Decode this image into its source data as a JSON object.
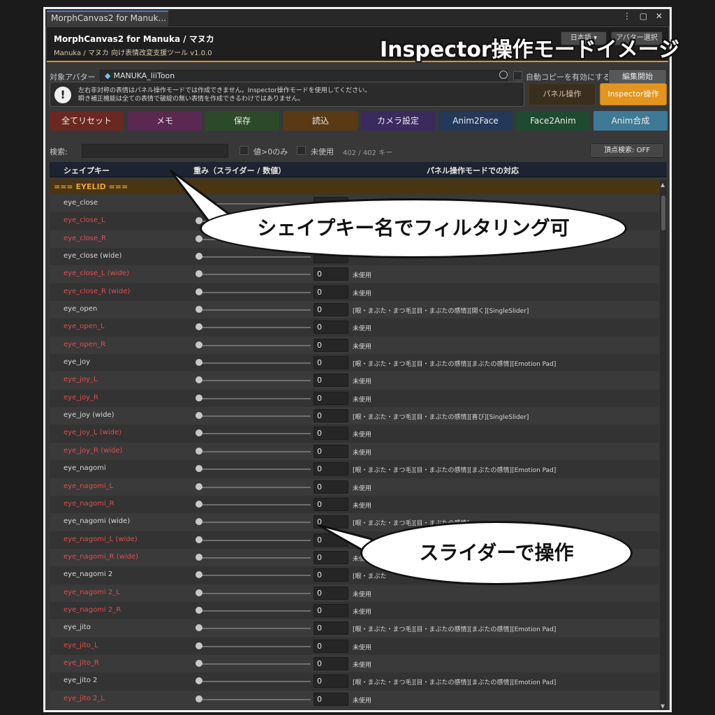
{
  "window": {
    "tab_title": "MorphCanvas2 for Manuk...",
    "controls": "⋮ ▢ ✕"
  },
  "header": {
    "title": "MorphCanvas2 for Manuka / マヌカ",
    "subtitle": "Manuka / マヌカ 向け表情改変支援ツール v1.0.0",
    "lang_button": "日本語 ▾",
    "avatar_select_button": "アバター選択"
  },
  "overlay_title": "Inspector操作モードイメージ",
  "avatar_row": {
    "label": "対象アバター",
    "avatar_name": "MANUKA_liiToon",
    "auto_copy_label": "自動コピーを有効にする",
    "edit_button": "編集開始"
  },
  "warning": {
    "line1": "左右非対称の表情はパネル操作モードでは作成できません。Inspector操作モードを使用してください。",
    "line2": "瞬き補正機能は全ての表情で破綻の無い表情を作成できるわけではありません。"
  },
  "modes": {
    "panel_label": "パネル操作",
    "inspector_label": "Inspector操作"
  },
  "actions": [
    {
      "label": "全てリセット",
      "color": "#6a2820"
    },
    {
      "label": "メモ",
      "color": "#5a2850"
    },
    {
      "label": "保存",
      "color": "#2c4a2a"
    },
    {
      "label": "読込",
      "color": "#5a3a14"
    },
    {
      "label": "カメラ設定",
      "color": "#3a2a5e"
    },
    {
      "label": "Anim2Face",
      "color": "#24385a"
    },
    {
      "label": "Face2Anim",
      "color": "#1e4a30"
    },
    {
      "label": "Anim合成",
      "color": "#3e7a96"
    }
  ],
  "search": {
    "label": "検索:",
    "value": "",
    "nonzero_label": "値>0のみ",
    "unused_label": "未使用",
    "count": "402 / 402 キー",
    "vertex_button": "頂点検索: OFF"
  },
  "table_headers": {
    "shapekey": "シェイプキー",
    "weight": "重み（スライダー / 数値）",
    "correspondence": "パネル操作モードでの対応"
  },
  "group": "=== EYELID ===",
  "rows": [
    {
      "name": "eye_close",
      "value": "",
      "cor": "",
      "asym": false
    },
    {
      "name": "eye_close_L",
      "value": "",
      "cor": "",
      "asym": true
    },
    {
      "name": "eye_close_R",
      "value": "",
      "cor": "",
      "asym": true
    },
    {
      "name": "eye_close (wide)",
      "value": "",
      "cor": "",
      "asym": false
    },
    {
      "name": "eye_close_L (wide)",
      "value": "0",
      "cor": "未使用",
      "asym": true
    },
    {
      "name": "eye_close_R (wide)",
      "value": "0",
      "cor": "未使用",
      "asym": true
    },
    {
      "name": "eye_open",
      "value": "0",
      "cor": "[眼・まぶた・まつ毛][目・まぶたの感情][開く][SingleSlider]",
      "asym": false
    },
    {
      "name": "eye_open_L",
      "value": "0",
      "cor": "未使用",
      "asym": true
    },
    {
      "name": "eye_open_R",
      "value": "0",
      "cor": "未使用",
      "asym": true
    },
    {
      "name": "eye_joy",
      "value": "0",
      "cor": "[眼・まぶた・まつ毛][目・まぶたの感情][まぶたの感情][Emotion Pad]",
      "asym": false
    },
    {
      "name": "eye_joy_L",
      "value": "0",
      "cor": "未使用",
      "asym": true
    },
    {
      "name": "eye_joy_R",
      "value": "0",
      "cor": "未使用",
      "asym": true
    },
    {
      "name": "eye_joy (wide)",
      "value": "0",
      "cor": "[眼・まぶた・まつ毛][目・まぶたの感情][喜び][SingleSlider]",
      "asym": false
    },
    {
      "name": "eye_joy_L (wide)",
      "value": "0",
      "cor": "未使用",
      "asym": true
    },
    {
      "name": "eye_joy_R (wide)",
      "value": "0",
      "cor": "未使用",
      "asym": true
    },
    {
      "name": "eye_nagomi",
      "value": "0",
      "cor": "[眼・まぶた・まつ毛][目・まぶたの感情][まぶたの感情][Emotion Pad]",
      "asym": false
    },
    {
      "name": "eye_nagomi_L",
      "value": "0",
      "cor": "未使用",
      "asym": true
    },
    {
      "name": "eye_nagomi_R",
      "value": "0",
      "cor": "未使用",
      "asym": true
    },
    {
      "name": "eye_nagomi (wide)",
      "value": "0",
      "cor": "[眼・まぶた・まつ毛][目・まぶたの感情]",
      "asym": false
    },
    {
      "name": "eye_nagomi_L (wide)",
      "value": "0",
      "cor": "",
      "asym": true
    },
    {
      "name": "eye_nagomi_R (wide)",
      "value": "0",
      "cor": "未使",
      "asym": true
    },
    {
      "name": "eye_nagomi 2",
      "value": "0",
      "cor": "[眼・まぶた",
      "asym": false
    },
    {
      "name": "eye_nagomi 2_L",
      "value": "0",
      "cor": "未使用",
      "asym": true
    },
    {
      "name": "eye_nagomi 2_R",
      "value": "0",
      "cor": "未使用",
      "asym": true
    },
    {
      "name": "eye_jito",
      "value": "0",
      "cor": "[眼・まぶた・まつ毛][目・まぶたの感情][まぶたの感情][Emotion Pad]",
      "asym": false
    },
    {
      "name": "eye_jito_L",
      "value": "0",
      "cor": "未使用",
      "asym": true
    },
    {
      "name": "eye_jito_R",
      "value": "0",
      "cor": "未使用",
      "asym": true
    },
    {
      "name": "eye_jito 2",
      "value": "0",
      "cor": "[眼・まぶた・まつ毛][目・まぶたの感情][まぶたの感情][Emotion Pad]",
      "asym": false
    },
    {
      "name": "eye_jito 2_L",
      "value": "0",
      "cor": "未使用",
      "asym": true
    }
  ],
  "callouts": {
    "filter": "シェイプキー名でフィルタリング可",
    "slider": "スライダーで操作"
  },
  "colors": {
    "accent_orange": "#e3951e",
    "asym_red": "#e24d4d",
    "inspector_active": "#e3951e"
  }
}
